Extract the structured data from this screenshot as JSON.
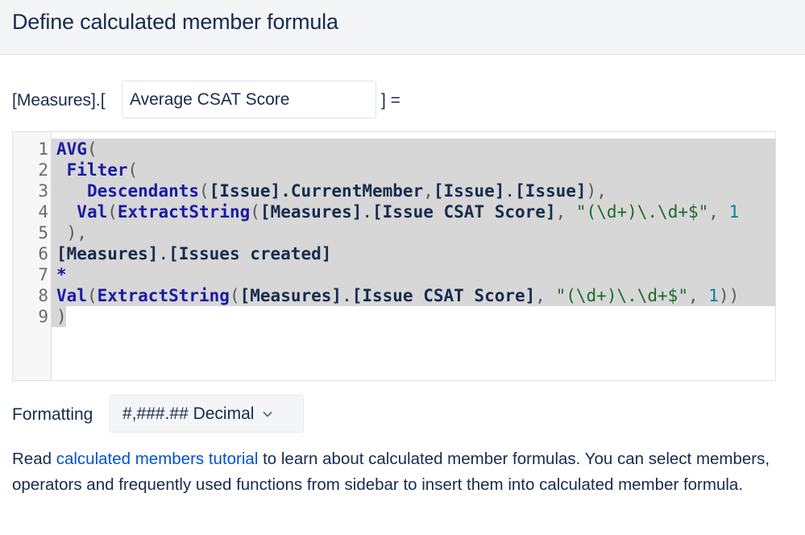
{
  "header": {
    "title": "Define calculated member formula"
  },
  "measure": {
    "prefix": "[Measures].[",
    "name_value": "Average CSAT Score",
    "suffix": "] ="
  },
  "editor": {
    "line_numbers": [
      "1",
      "2",
      "3",
      "4",
      "5",
      "6",
      "7",
      "8",
      "9"
    ],
    "lines": [
      "AVG(",
      " Filter(",
      "   Descendants([Issue].CurrentMember,[Issue].[Issue]),",
      "  Val(ExtractString([Measures].[Issue CSAT Score], \"(\\d+)\\.\\d+$\", 1",
      " ),",
      "[Measures].[Issues created]",
      "*",
      "Val(ExtractString([Measures].[Issue CSAT Score], \"(\\d+)\\.\\d+$\", 1))",
      ")"
    ]
  },
  "formatting": {
    "label": "Formatting",
    "selected": "#,###.## Decimal",
    "icon": "chevron-down-icon"
  },
  "help": {
    "prefix": "Read ",
    "link_text": "calculated members tutorial",
    "suffix": " to learn about calculated member formulas. You can select members, operators and frequently used functions from sidebar to insert them into calculated member formula."
  },
  "colors": {
    "link": "#0052cc",
    "text": "#172b4d",
    "keyword": "#1a1aa6",
    "string": "#1b6b2a",
    "number": "#0a7ea4",
    "selection": "#d7d7d7"
  }
}
